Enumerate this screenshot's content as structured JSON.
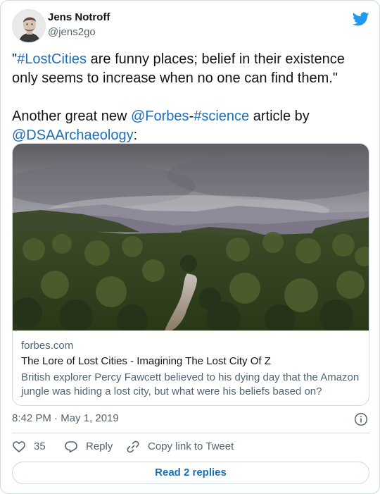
{
  "author": {
    "name": "Jens Notroff",
    "handle": "@jens2go"
  },
  "tweet": {
    "line1_open_quote": "\"",
    "line1_hashtag": "#LostCities",
    "line1_rest": " are funny places; belief in their existence only seems to increase when no one can find them.\"",
    "line2_start": "Another great new ",
    "line2_mention1": "@Forbes",
    "line2_dash": "-",
    "line2_hashtag": "#science",
    "line2_mid": " article by ",
    "line2_mention2": "@DSAArchaeology",
    "line2_end": ":"
  },
  "link_card": {
    "domain": "forbes.com",
    "title": "The Lore of Lost Cities - Imagining The Lost City Of Z",
    "description": "British explorer Percy Fawcett believed to his dying day that the Amazon jungle was hiding a lost city, but what were his beliefs based on?",
    "image_icon": "jungle-river-photo"
  },
  "timestamp": "8:42 PM · May 1, 2019",
  "actions": {
    "like_count": "35",
    "reply_label": "Reply",
    "copy_label": "Copy link to Tweet"
  },
  "read_replies_label": "Read 2 replies",
  "colors": {
    "link": "#1d6fb8",
    "twitter_blue": "#1d9bf0",
    "secondary_text": "#536471",
    "border": "#cfd9de"
  },
  "icons": [
    "twitter-bird-icon",
    "info-icon",
    "heart-icon",
    "reply-icon",
    "link-icon"
  ]
}
